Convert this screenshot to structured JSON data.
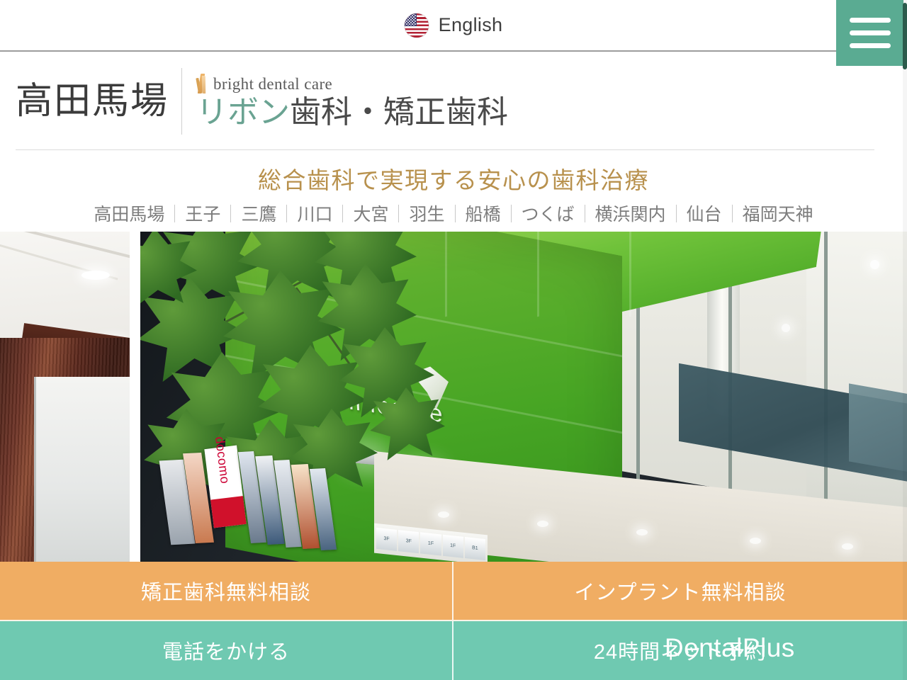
{
  "topbar": {
    "language_label": "English",
    "flag_icon": "us-flag-icon"
  },
  "menu": {
    "hamburger_icon": "hamburger-menu-icon"
  },
  "logo": {
    "city": "高田馬場",
    "english_tagline": "bright dental care",
    "ribbon_icon": "ribbon-icon",
    "name_teal": "リボン",
    "name_gray": "歯科・矯正歯科"
  },
  "tagline": "総合歯科で実現する安心の歯科治療",
  "city_nav": [
    "高田馬場",
    "王子",
    "三鷹",
    "川口",
    "大宮",
    "羽生",
    "船橋",
    "つくば",
    "横浜関内",
    "仙台",
    "福岡天神"
  ],
  "hero": {
    "building_sign": "Primegate",
    "street_sign": "docomo"
  },
  "cta": {
    "ortho_free": "矯正歯科無料相談",
    "implant_free": "インプラント無料相談",
    "call_phone": "電話をかける",
    "net_reserve": "24時間ネット予約",
    "net_reserve_brand": "DentalPlus"
  },
  "colors": {
    "accent_green": "#6fc9b1",
    "accent_orange": "#f0ad63",
    "menu_green": "#5aab92",
    "tagline_gold": "#b8914d",
    "logo_teal": "#6aa392",
    "scrollbar": "#2c5b4c"
  }
}
